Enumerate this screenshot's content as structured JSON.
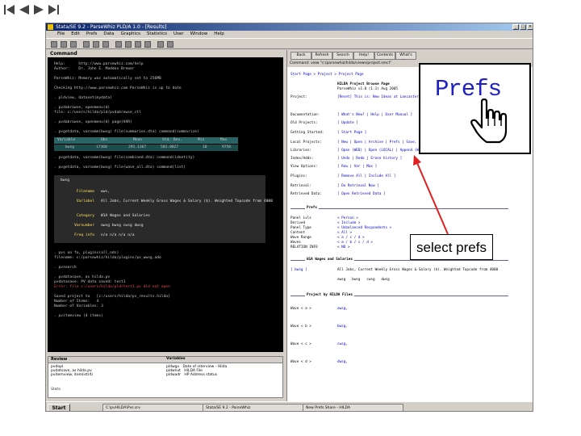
{
  "window": {
    "title": "Stata/SE 9.2 - ParseWhiz PLD/A 1.0 - [Results]",
    "menu": [
      "File",
      "Edit",
      "Prefs",
      "Data",
      "Graphics",
      "Statistics",
      "User",
      "Window",
      "Help"
    ]
  },
  "console_panel": {
    "title": "Command",
    "lines": [
      "Help:      http://www.parsewhiz.com/help",
      "Author:    Dr. John E. Maddox Brewer",
      "",
      "ParseWhiz: Memory was automatically set to 256MB",
      "",
      "Checking http://www.parsewhiz.com ParseWhiz is up to date",
      "",
      ". pldview, dataset(mydata)",
      "",
      ". pvdabrowse, openmenu(d)",
      "file: c:/users/hilda/pld/pvdabrowse_ctl",
      "",
      ". pvdabrowse, openmenu(d) page(VAR)",
      "",
      ". pvgetdata, varname(bwsg) file(summaries.dta) command(summarize)"
    ],
    "table": {
      "headers": [
        "Variable",
        "Obs",
        "Mean",
        "Std. Dev.",
        "Min",
        "Max"
      ],
      "row": [
        "bwsg",
        "17360",
        "291.1367",
        "503.0027",
        "10",
        "9750"
      ]
    },
    "lines2": [
      ". pvgetdata, varname(bwsg) file(combined.dta) command(identity)",
      "",
      ". pvgetdata, varname(bwsg) file(wave_all.dta) command(list)"
    ],
    "record": {
      "header": "bwsg",
      "fields": [
        {
          "label": "Filename",
          "value": "wwc,"
        },
        {
          "label": "Varlabel",
          "value": "All Jobs, Current Weekly Gross Wages & Salary ($). Weighted Topcode from 4000"
        },
        {
          "label": "Category",
          "value": "W1A Wages and Salaries"
        },
        {
          "label": "Varnumber",
          "value": "awsg bwsg cwsg dwsg"
        },
        {
          "label": "Freq info",
          "value": "n/a   n/a   n/a   n/a"
        }
      ]
    },
    "lines3": [
      ". pvs on fo, plugins(all_nds)",
      "filename: c:/parsewhiz/hilda/plugins/pv_wwsg.ado",
      "",
      ". pvsearch",
      "",
      ". pvdatasave, as hilda.pv",
      "pvdatasave: PV data saved: test1",
      "Error: file c:/users/hilda/pld/test1.pv did not open",
      "",
      "Saved project to   [c:/users/hilda/pv_results.hilda]",
      "Number of Items:   4",
      "Number of Variables: 3",
      "",
      ". pvitemview (4 items)"
    ]
  },
  "review_panel": {
    "title": "Review",
    "commands": [
      "pvdopl",
      "pvdatsave, as hilda.pv",
      "pvitemview, itemlist(4)"
    ],
    "variables_title": "Variables",
    "variables": [
      {
        "name": "pldwgv",
        "label": "Date of interview - Hilda"
      },
      {
        "name": "pldwnxt",
        "label": "HILDA File"
      },
      {
        "name": "pldwadr",
        "label": "HP Address status"
      }
    ],
    "status": "Stata"
  },
  "viewer": {
    "toolbar_buttons": [
      "Back",
      "Refresh",
      "Search",
      "Help!",
      "Contents",
      "What's New"
    ],
    "address": "Command: view \"c:/parsewhiz/hilda/views/project.smcl\"",
    "breadcrumb": "Start Page > Project > Project Page",
    "heading": "HILDA Project Browse Page",
    "version": "ParseWhiz v1.0 (1.1) Aug 2005",
    "rows": [
      {
        "label": "Project:",
        "value": "[Reset] This is: New Ideas at Lancaster"
      },
      {
        "label": "Documentation:",
        "value": "[ What's New? | Help | User Manual ]"
      },
      {
        "label": "Old Projects:",
        "value": "[ Update ]"
      },
      {
        "label": "Getting Started:",
        "value": "[ Start Page ]"
      },
      {
        "label": "Local Projects:",
        "value": "[ New | Open | Archive | Prefs | Save, as | Save | Append ]"
      },
      {
        "label": "Libraries:",
        "value": "[ Open (WEB) | Open (LOCAL) | Append (WEB) | Append (LOCAL) ]"
      },
      {
        "label": "Index/Adds:",
        "value": "[ Undo | Redo | Erase history ]"
      },
      {
        "label": "View Options:",
        "value": "[ Row | Var | Max ]"
      },
      {
        "label": "Plugins:",
        "value": "[ Remove All | Include All ]"
      },
      {
        "label": "Retrieval:",
        "value": "[ Do Retrieval Now ]"
      },
      {
        "label": "Retrieved Data:",
        "value": "[ Open Retrieved Data ]"
      }
    ],
    "prefs_section": "Prefs",
    "prefs_rows": [
      {
        "label": "Panel Lvls",
        "value": "< Person >"
      },
      {
        "label": "Derived",
        "value": "< Include >"
      },
      {
        "label": "Panel Type",
        "value": "< Unbalanced Respondents >"
      },
      {
        "label": "Content",
        "value": "< All >"
      },
      {
        "label": "Wave Range",
        "value": "< a / c / d >"
      },
      {
        "label": "Waves",
        "value": "< a / b / c / d >"
      },
      {
        "label": "RELATION INFO",
        "value": "< NO >"
      }
    ],
    "wages_section": "W1A Wages and Salaries",
    "wages_row": {
      "label": "[ bwsg ]",
      "value": "All Jobs, Current Weekly Gross Wages & Salary ($). Weighted Topcode from 4000"
    },
    "wages_vars": [
      "awsg",
      "bwsg",
      "cwsg",
      "dwsg"
    ],
    "project_section": "Project by HILDA Files",
    "wave_rows": [
      {
        "label": "Wave < a >",
        "value": "awsg,"
      },
      {
        "label": "Wave < b >",
        "value": "bwsg,"
      },
      {
        "label": "Wave < c >",
        "value": "cwsg,"
      },
      {
        "label": "Wave < d >",
        "value": "dwsg,"
      }
    ]
  },
  "taskbar": {
    "start_label": "Start",
    "tasks": [
      "C:\\pvHILDA\\Pvs.srv",
      "Stata/SE 9.2 - ParseWhiz",
      "New Prefs Share - HILDA"
    ]
  },
  "zoom": {
    "label": "Prefs"
  },
  "callout": {
    "text": "select prefs"
  },
  "colors": {
    "console_bg": "#000000",
    "zoom_text": "#2020c0",
    "arrow": "#e02020"
  }
}
